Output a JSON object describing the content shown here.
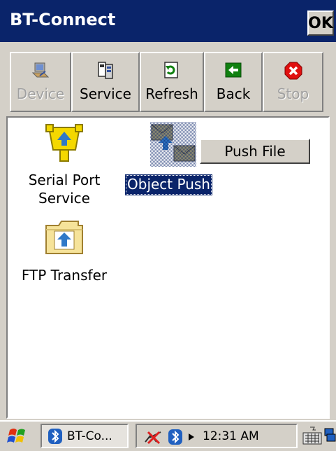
{
  "window": {
    "title": "BT-Connect",
    "ok_label": "OK"
  },
  "toolbar": {
    "device": "Device",
    "service": "Service",
    "refresh": "Refresh",
    "back": "Back",
    "stop": "Stop"
  },
  "services": {
    "serial_line1": "Serial Port",
    "serial_line2": "Service",
    "object_push": "Object Push",
    "ftp": "FTP Transfer"
  },
  "context_menu": {
    "push_file": "Push File"
  },
  "taskbar": {
    "task_label": "BT-Co...",
    "clock": "12:31 AM"
  },
  "icons": {
    "start": "windows-flag-icon",
    "device": "device-icon",
    "service": "service-icon",
    "refresh": "refresh-icon",
    "back": "back-arrow-icon",
    "stop": "stop-icon",
    "serial": "serial-port-icon",
    "object_push": "object-push-icon",
    "ftp": "ftp-folder-icon",
    "bluetooth": "bluetooth-icon",
    "connection": "connection-icon",
    "keyboard": "keyboard-icon",
    "desktop": "desktop-icon"
  },
  "colors": {
    "title_bg": "#0a246a",
    "selection": "#0a246a",
    "face": "#d4d0c8"
  }
}
